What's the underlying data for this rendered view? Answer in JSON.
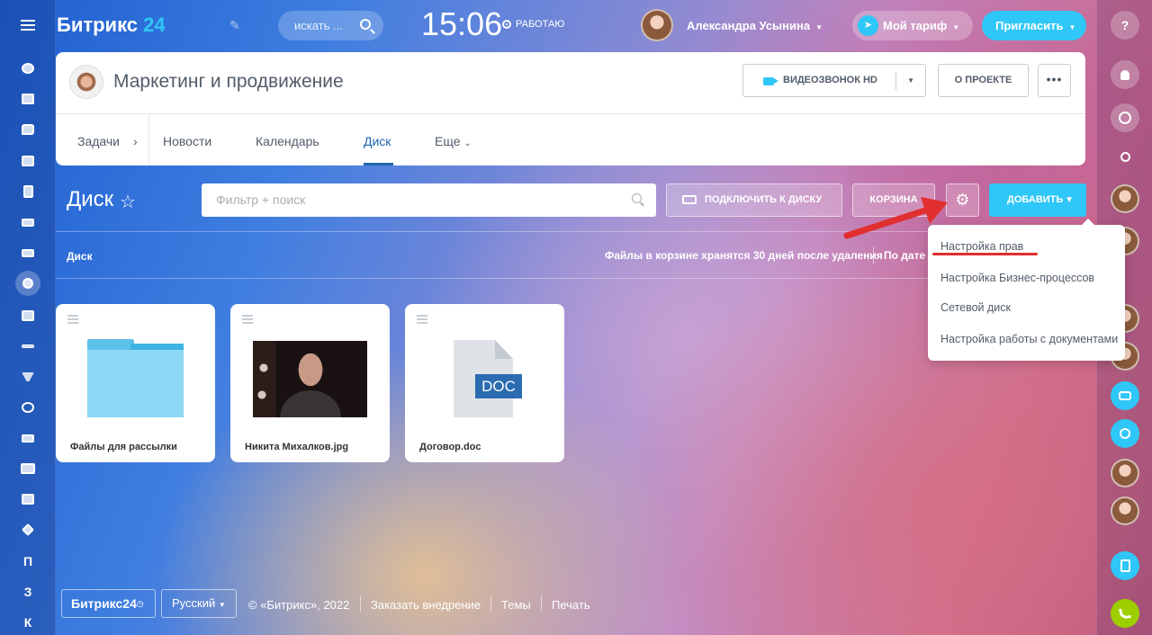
{
  "header": {
    "logo_text": "Битрикс",
    "logo_num": "24",
    "search_placeholder": "искать ...",
    "clock": "15:06",
    "status": "РАБОТАЮ",
    "user_name": "Александра Усынина",
    "tariff_label": "Мой тариф",
    "invite_label": "Пригласить"
  },
  "project": {
    "title": "Маркетинг и продвижение",
    "video_btn": "ВИДЕОЗВОНОК HD",
    "about_btn": "О ПРОЕКТЕ",
    "more_btn": "•••",
    "tabs": [
      {
        "label": "Задачи"
      },
      {
        "label": "Новости"
      },
      {
        "label": "Календарь"
      },
      {
        "label": "Диск"
      },
      {
        "label": "Еще"
      }
    ],
    "tasks_chevron": "›"
  },
  "disk": {
    "title": "Диск",
    "filter_placeholder": "Фильтр + поиск",
    "connect_btn": "ПОДКЛЮЧИТЬ К ДИСКУ",
    "trash_btn": "КОРЗИНА",
    "add_btn": "ДОБАВИТЬ",
    "breadcrumb": "Диск",
    "trash_info": "Файлы в корзине хранятся 30 дней после удаления",
    "sort_label": "По дате",
    "files": [
      {
        "name": "Файлы для рассылки",
        "type": "folder"
      },
      {
        "name": "Никита Михалков.jpg",
        "type": "image"
      },
      {
        "name": "Договор.doc",
        "type": "doc",
        "badge": "DOC"
      }
    ]
  },
  "settings_menu": {
    "items": [
      {
        "label": "Настройка прав"
      },
      {
        "label": "Настройка Бизнес-процессов"
      },
      {
        "label": "Сетевой диск"
      },
      {
        "label": "Настройка работы с документами"
      }
    ]
  },
  "left_sidebar": {
    "letters": [
      "П",
      "З",
      "К"
    ]
  },
  "footer": {
    "logo": "Битрикс24",
    "language": "Русский",
    "copyright": "© «Битрикс», 2022",
    "order": "Заказать внедрение",
    "themes": "Темы",
    "print": "Печать"
  },
  "colors": {
    "accent": "#2fc7f7",
    "link": "#2067b0",
    "annotation": "#e12e2e"
  }
}
